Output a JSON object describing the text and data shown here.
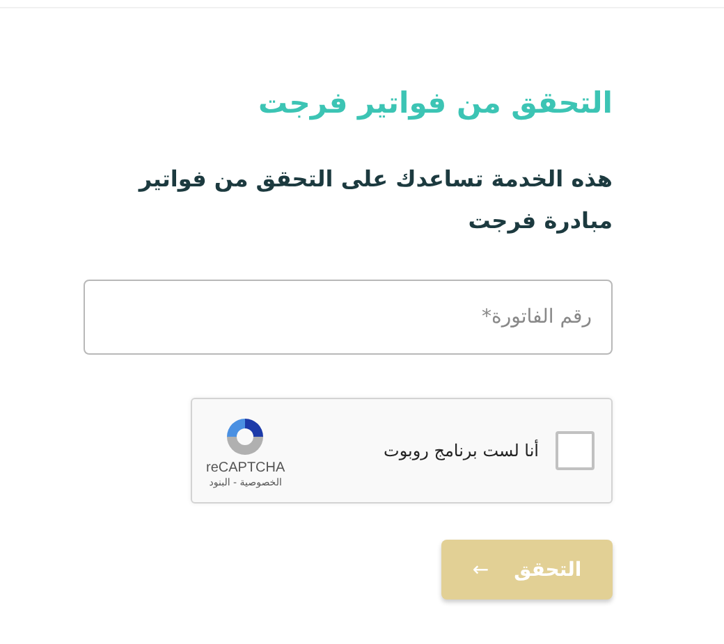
{
  "title": "التحقق من فواتير فرجت",
  "description": "هذه الخدمة تساعدك على التحقق من فواتير مبادرة فرجت",
  "invoice_field": {
    "placeholder": "رقم الفاتورة*"
  },
  "captcha": {
    "label": "أنا لست برنامج روبوت",
    "checked": false,
    "brand": "reCAPTCHA",
    "links": "الخصوصية - البنود"
  },
  "submit_button": {
    "label": "التحقق",
    "icon": "←",
    "disabled": true
  }
}
